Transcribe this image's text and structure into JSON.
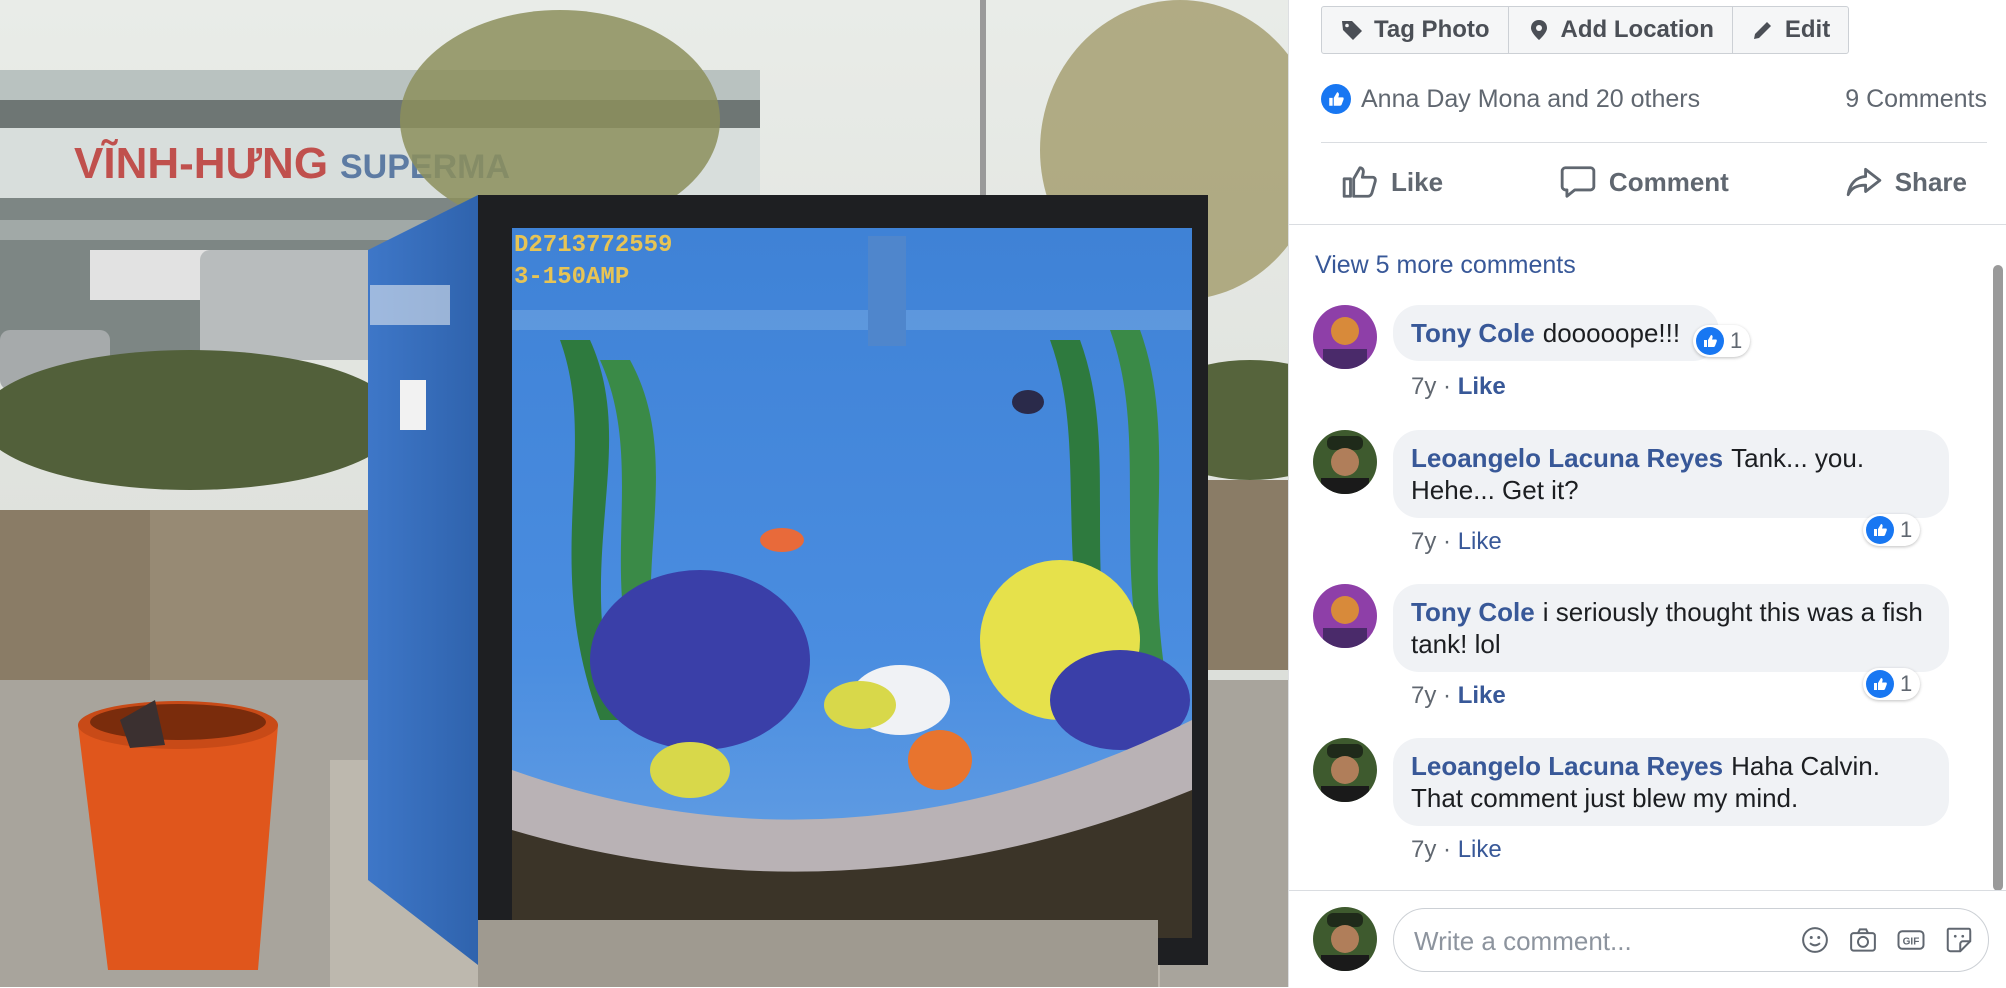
{
  "photo": {
    "store_sign": "VĨNH-HƯNG",
    "store_sign_suffix": "SUPERMA",
    "box_serial": "D2713772559",
    "box_rating": "3-150AMP"
  },
  "toolbar": {
    "tag_photo": "Tag Photo",
    "add_location": "Add Location",
    "edit": "Edit"
  },
  "reactions": {
    "summary": "Anna Day Mona and 20 others",
    "comments_count": "9 Comments"
  },
  "actions": {
    "like": "Like",
    "comment": "Comment",
    "share": "Share"
  },
  "view_more": "View 5 more comments",
  "comments": [
    {
      "author": "Tony Cole",
      "text": "dooooope!!!",
      "time": "7y",
      "like_label": "Like",
      "reaction_count": "1"
    },
    {
      "author": "Leoangelo Lacuna Reyes",
      "text": "Tank... you. Hehe... Get it?",
      "time": "7y",
      "like_label": "Like",
      "reaction_count": "1"
    },
    {
      "author": "Tony Cole",
      "text": "i seriously thought this was a fish tank! lol",
      "time": "7y",
      "like_label": "Like",
      "reaction_count": "1"
    },
    {
      "author": "Leoangelo Lacuna Reyes",
      "text": "Haha Calvin. That comment just blew my mind.",
      "time": "7y",
      "like_label": "Like",
      "reaction_count": ""
    }
  ],
  "composer": {
    "placeholder": "Write a comment...",
    "icons": [
      "emoji-icon",
      "camera-icon",
      "gif-icon",
      "sticker-icon"
    ]
  },
  "colors": {
    "link": "#385898",
    "facebook_blue": "#1877f2",
    "bubble": "#f0f2f5",
    "text_secondary": "#606770"
  }
}
